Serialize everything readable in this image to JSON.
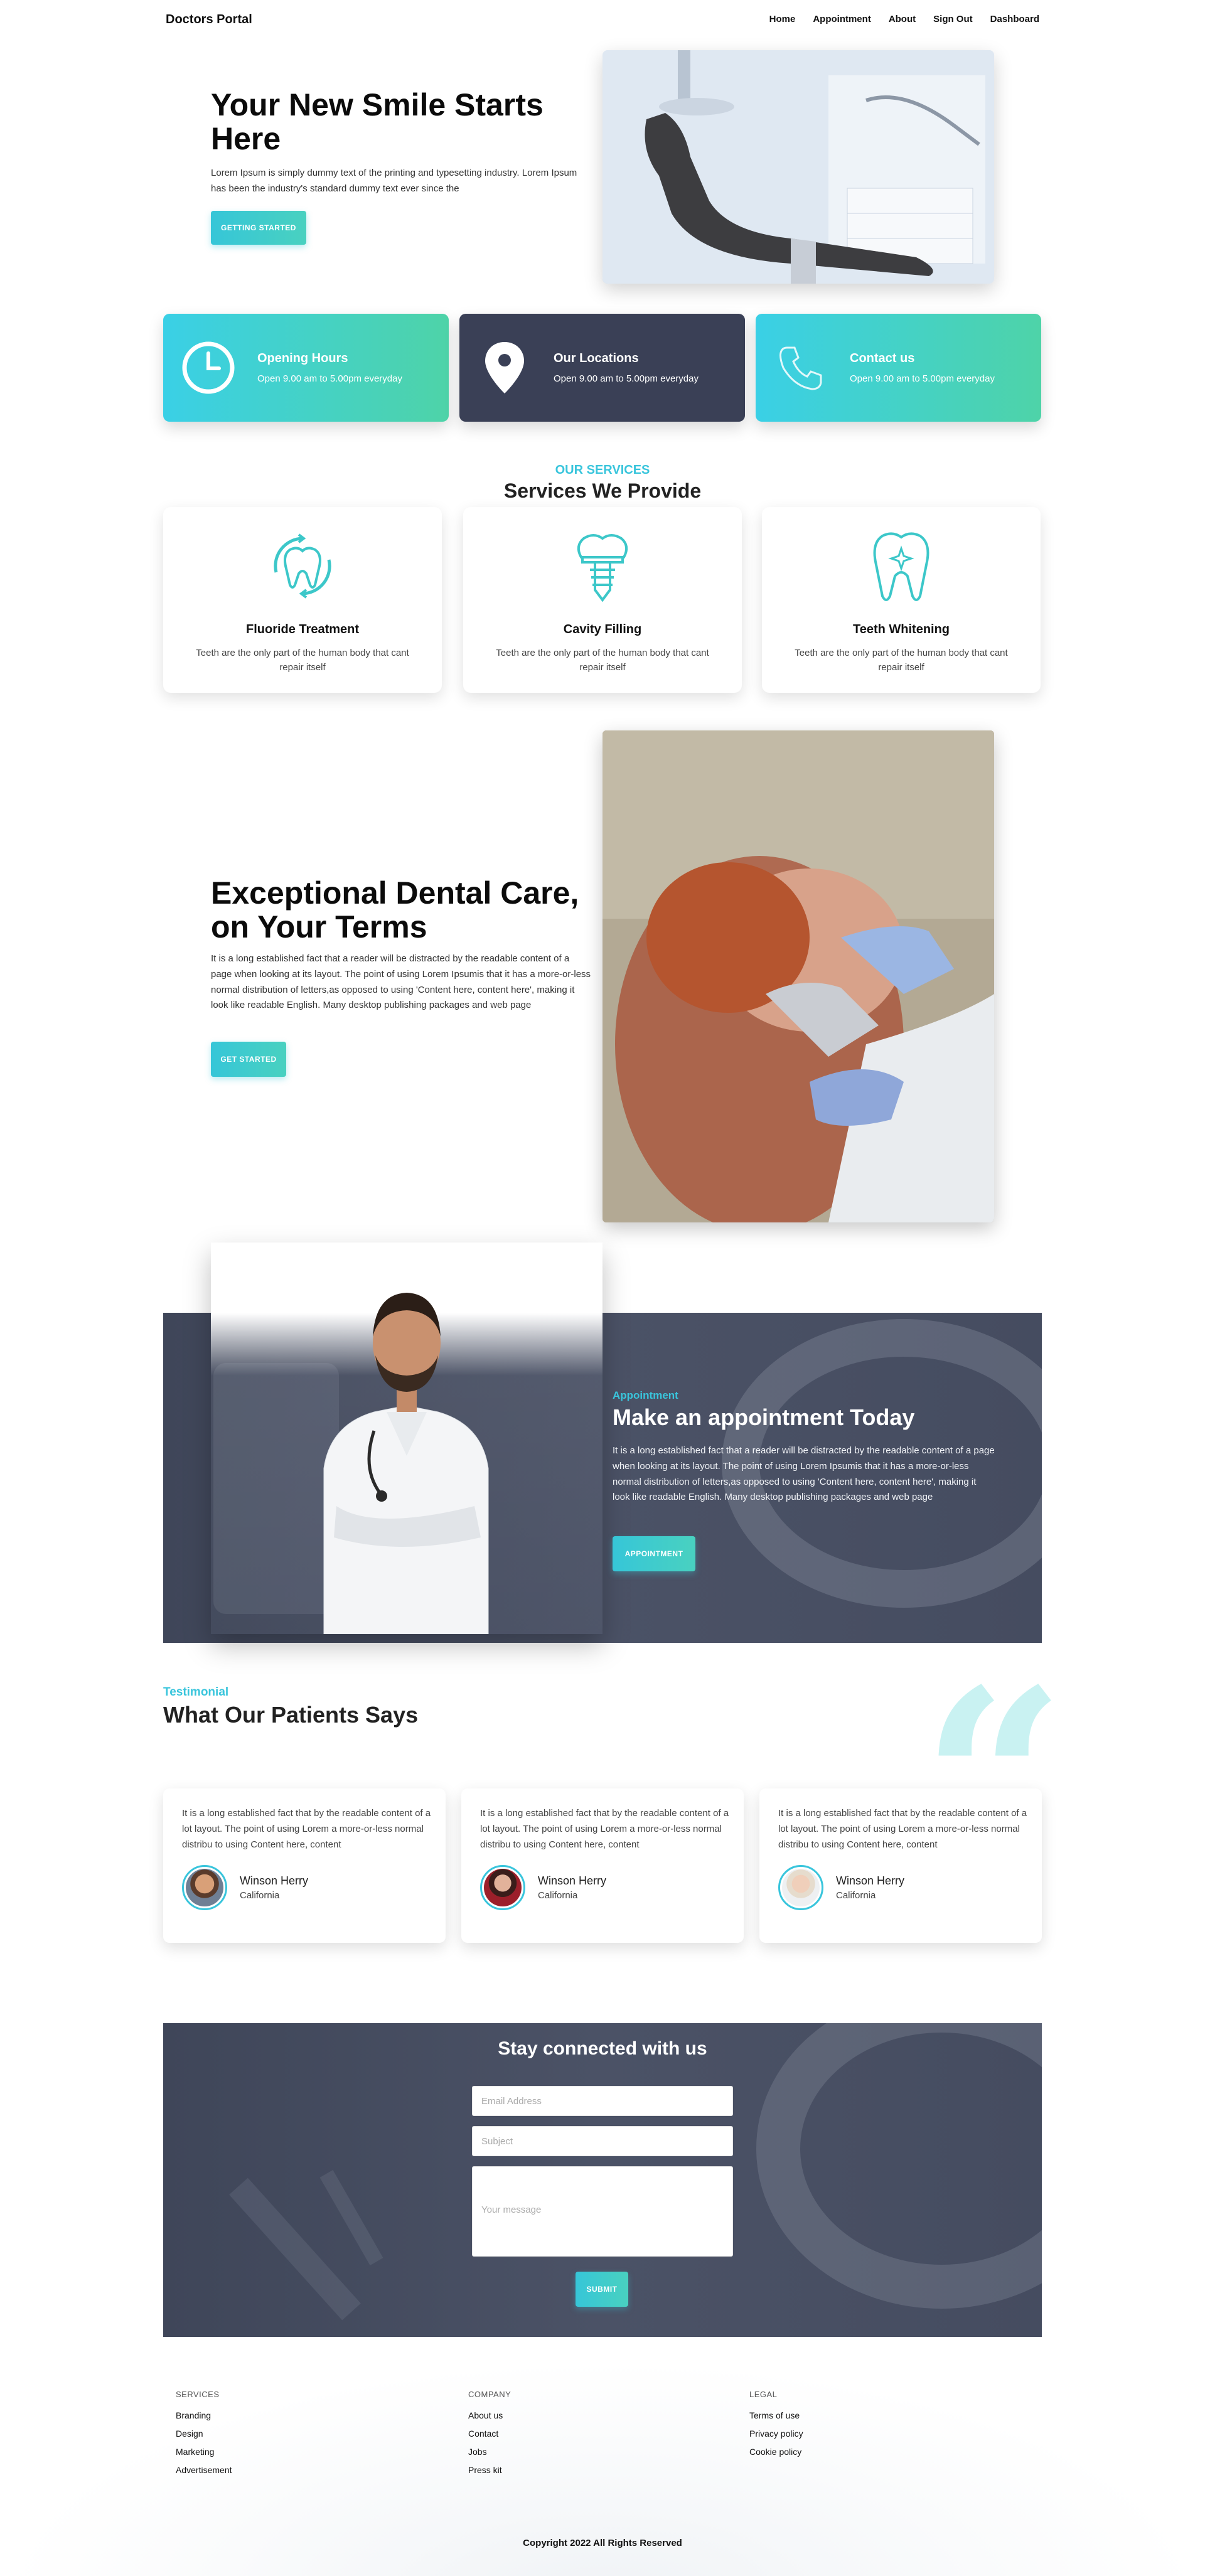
{
  "nav": {
    "brand": "Doctors Portal",
    "links": [
      "Home",
      "Appointment",
      "About",
      "Sign Out",
      "Dashboard"
    ]
  },
  "hero": {
    "title": "Your New Smile Starts Here",
    "text": "Lorem Ipsum is simply dummy text of the printing and typesetting industry. Lorem Ipsum has been the industry's standard dummy text ever since the",
    "button": "GETTING STARTED"
  },
  "info": [
    {
      "title": "Opening Hours",
      "text": "Open 9.00 am to 5.00pm everyday",
      "icon": "clock-icon"
    },
    {
      "title": "Our Locations",
      "text": "Open 9.00 am to 5.00pm everyday",
      "icon": "location-pin-icon"
    },
    {
      "title": "Contact us",
      "text": "Open 9.00 am to 5.00pm everyday",
      "icon": "phone-icon"
    }
  ],
  "services": {
    "kicker": "OUR SERVICES",
    "title": "Services We Provide",
    "items": [
      {
        "name": "Fluoride Treatment",
        "desc": "Teeth are the only part of the human body that cant repair itself",
        "icon": "tooth-cycle-icon"
      },
      {
        "name": "Cavity Filling",
        "desc": "Teeth are the only part of the human body that cant repair itself",
        "icon": "tooth-implant-icon"
      },
      {
        "name": "Teeth Whitening",
        "desc": "Teeth are the only part of the human body that cant repair itself",
        "icon": "tooth-sparkle-icon"
      }
    ]
  },
  "care": {
    "title": "Exceptional Dental Care, on Your Terms",
    "text": "It is a long established fact that a reader will be distracted by the readable content of a page when looking at its layout. The point of using Lorem Ipsumis that it has a more-or-less normal distribution of letters,as opposed to using 'Content here, content here', making it look like readable English. Many desktop publishing packages and web page",
    "button": "GET STARTED"
  },
  "appointment": {
    "kicker": "Appointment",
    "title": "Make an appointment Today",
    "text": "It is a long established fact that a reader will be distracted by the readable content of a page when looking at its layout. The point of using Lorem Ipsumis that it has a more-or-less normal distribution of letters,as opposed to using 'Content here, content here', making it look like readable English. Many desktop publishing packages and web page",
    "button": "APPOINTMENT"
  },
  "testimonial": {
    "kicker": "Testimonial",
    "title": "What Our Patients Says",
    "items": [
      {
        "text": "It is a long established fact that by the readable content of a lot layout. The point of using Lorem a more-or-less normal distribu to using Content here, content",
        "name": "Winson Herry",
        "location": "California"
      },
      {
        "text": "It is a long established fact that by the readable content of a lot layout. The point of using Lorem a more-or-less normal distribu to using Content here, content",
        "name": "Winson Herry",
        "location": "California"
      },
      {
        "text": "It is a long established fact that by the readable content of a lot layout. The point of using Lorem a more-or-less normal distribu to using Content here, content",
        "name": "Winson Herry",
        "location": "California"
      }
    ]
  },
  "contact": {
    "title": "Stay connected with us",
    "email_placeholder": "Email Address",
    "subject_placeholder": "Subject",
    "message_placeholder": "Your message",
    "button": "SUBMIT"
  },
  "footer": {
    "columns": [
      {
        "heading": "SERVICES",
        "links": [
          "Branding",
          "Design",
          "Marketing",
          "Advertisement"
        ]
      },
      {
        "heading": "COMPANY",
        "links": [
          "About us",
          "Contact",
          "Jobs",
          "Press kit"
        ]
      },
      {
        "heading": "LEGAL",
        "links": [
          "Terms of use",
          "Privacy policy",
          "Cookie policy"
        ]
      }
    ],
    "copyright": "Copyright 2022 All Rights Reserved"
  },
  "colors": {
    "accent": "#39c5dc",
    "accent_green": "#4ed3a8",
    "dark_panel": "#3a4056"
  }
}
